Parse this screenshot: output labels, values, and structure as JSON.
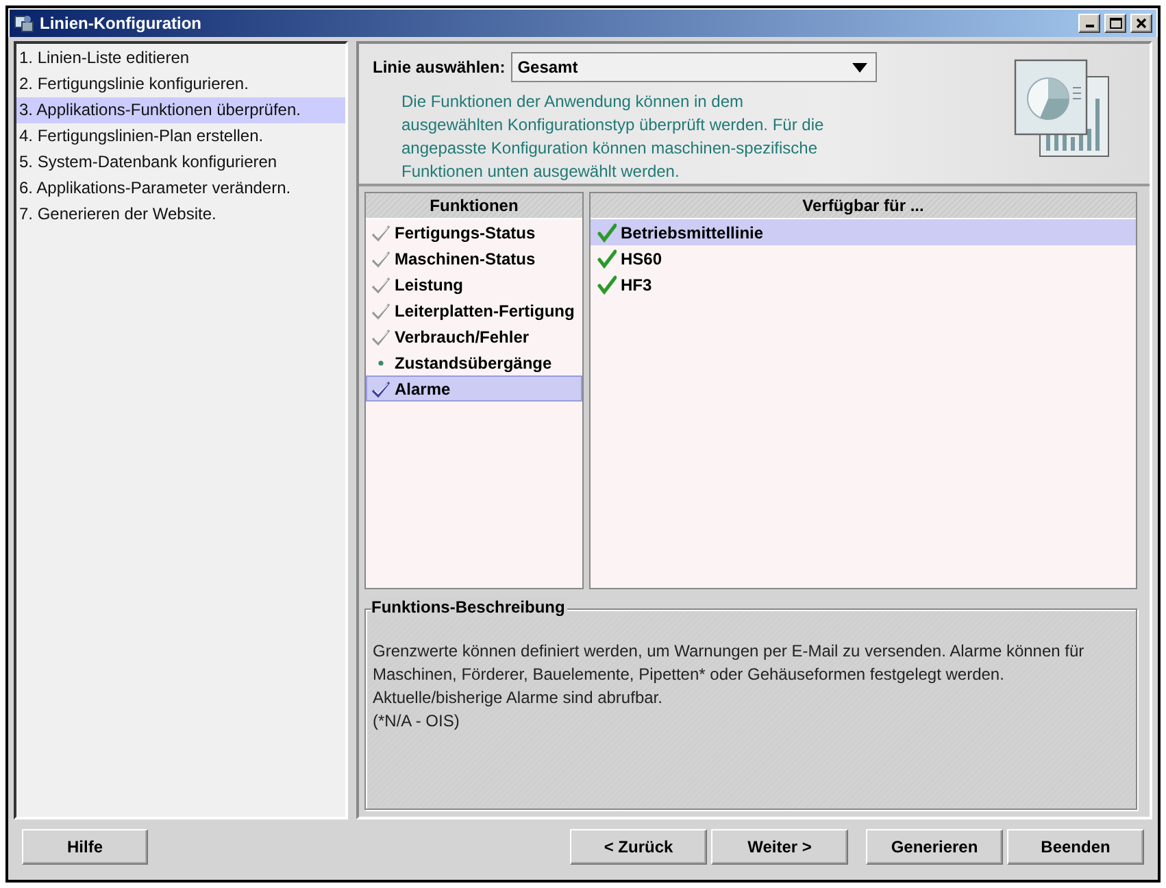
{
  "window": {
    "title": "Linien-Konfiguration"
  },
  "steps": [
    {
      "label": "1. Linien-Liste editieren",
      "selected": false
    },
    {
      "label": "2. Fertigungslinie konfigurieren.",
      "selected": false
    },
    {
      "label": "3. Applikations-Funktionen überprüfen.",
      "selected": true
    },
    {
      "label": "4. Fertigungslinien-Plan erstellen.",
      "selected": false
    },
    {
      "label": "5. System-Datenbank konfigurieren",
      "selected": false
    },
    {
      "label": "6. Applikations-Parameter verändern.",
      "selected": false
    },
    {
      "label": "7. Generieren der Website.",
      "selected": false
    }
  ],
  "line_select": {
    "label": "Linie auswählen:",
    "value": "Gesamt"
  },
  "intro": "Die Funktionen der Anwendung können in dem ausgewählten Konfigurationstyp überprüft werden. Für die angepasste Konfiguration können maschinen-spezifische Funktionen unten ausgewählt werden.",
  "functions": {
    "columns": [
      "Funktionen",
      "Verfügbar für ..."
    ],
    "items": [
      {
        "label": "Fertigungs-Status",
        "kind": "check",
        "selected": false
      },
      {
        "label": "Maschinen-Status",
        "kind": "check",
        "selected": false
      },
      {
        "label": "Leistung",
        "kind": "check",
        "selected": false
      },
      {
        "label": "Leiterplatten-Fertigung",
        "kind": "check",
        "selected": false
      },
      {
        "label": "Verbrauch/Fehler",
        "kind": "check",
        "selected": false
      },
      {
        "label": "Zustandsübergänge",
        "kind": "dot",
        "selected": false
      },
      {
        "label": "Alarme",
        "kind": "check",
        "selected": true
      }
    ],
    "available": [
      {
        "label": "Betriebsmittellinie",
        "selected": true
      },
      {
        "label": "HS60",
        "selected": false
      },
      {
        "label": "HF3",
        "selected": false
      }
    ]
  },
  "description": {
    "title": "Funktions-Beschreibung",
    "lines": [
      "Grenzwerte können definiert werden, um Warnungen per E-Mail zu versenden. Alarme können für Maschinen, Förderer, Bauelemente, Pipetten* oder Gehäuseformen festgelegt werden. Aktuelle/bisherige Alarme sind abrufbar.",
      "(*N/A - OIS)"
    ]
  },
  "buttons": {
    "left": [
      "Hilfe"
    ],
    "right": [
      "< Zurück",
      "Weiter >",
      "Generieren",
      "Beenden"
    ]
  }
}
